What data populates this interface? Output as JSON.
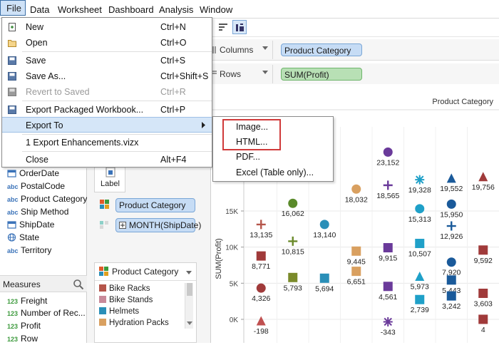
{
  "menubar": {
    "items": [
      "File",
      "Data",
      "Worksheet",
      "Dashboard",
      "Analysis",
      "Window"
    ]
  },
  "file_menu": {
    "items": [
      {
        "label": "New",
        "shortcut": "Ctrl+N",
        "icon": "new-file-icon",
        "enabled": true
      },
      {
        "label": "Open",
        "shortcut": "Ctrl+O",
        "icon": "open-folder-icon",
        "enabled": true
      },
      {
        "label": "Save",
        "shortcut": "Ctrl+S",
        "icon": "save-icon",
        "enabled": true
      },
      {
        "label": "Save As...",
        "shortcut": "Ctrl+Shift+S",
        "icon": "save-as-icon",
        "enabled": true
      },
      {
        "label": "Revert to Saved",
        "shortcut": "Ctrl+R",
        "icon": "revert-icon",
        "enabled": false
      },
      {
        "label": "Export Packaged Workbook...",
        "shortcut": "Ctrl+P",
        "icon": "export-packaged-icon",
        "enabled": true
      },
      {
        "label": "Export To",
        "shortcut": "",
        "icon": "",
        "enabled": true,
        "submenu": true
      },
      {
        "label": "1  Export Enhancements.vizx",
        "shortcut": "",
        "icon": "",
        "enabled": true
      },
      {
        "label": "Close",
        "shortcut": "Alt+F4",
        "icon": "",
        "enabled": true
      }
    ]
  },
  "export_submenu": {
    "items": [
      "Image...",
      "HTML...",
      "PDF...",
      "Excel (Table only)..."
    ]
  },
  "shelves": {
    "columns_label": "Columns",
    "columns_pill": "Product Category",
    "rows_label": "Rows",
    "rows_pill": "SUM(Profit)"
  },
  "data_pane": {
    "dimensions": [
      {
        "tag": "",
        "label": "OrderDate",
        "icon": "calendar-icon"
      },
      {
        "tag": "abc",
        "label": "PostalCode"
      },
      {
        "tag": "abc",
        "label": "Product Category"
      },
      {
        "tag": "abc",
        "label": "Ship Method"
      },
      {
        "tag": "",
        "label": "ShipDate",
        "icon": "calendar-icon"
      },
      {
        "tag": "",
        "label": "State",
        "icon": "globe-icon"
      },
      {
        "tag": "abc",
        "label": "Territory"
      }
    ],
    "measures_title": "Measures",
    "measures": [
      {
        "tag": "123",
        "label": "Freight"
      },
      {
        "tag": "123",
        "label": "Number of Rec..."
      },
      {
        "tag": "123",
        "label": "Profit"
      },
      {
        "tag": "123",
        "label": "Row"
      }
    ]
  },
  "marks_pane": {
    "label_button": "Label",
    "color_pill": "Product Category",
    "detail_pill": "MONTH(ShipDate)",
    "legend_title": "Product Category",
    "legend_items": [
      {
        "label": "Bike Racks",
        "color": "#b5554a"
      },
      {
        "label": "Bike Stands",
        "color": "#c98a9a"
      },
      {
        "label": "Helmets",
        "color": "#2a8fb8"
      },
      {
        "label": "Hydration Packs",
        "color": "#d9a060"
      }
    ]
  },
  "chart_data": {
    "type": "scatter",
    "header": "Product Category",
    "ylabel": "SUM(Profit)",
    "y_ticks": [
      "15K",
      "10K",
      "5K",
      "0K"
    ],
    "ylim": [
      -2000,
      22000
    ],
    "columns": [
      {
        "points": [
          {
            "y": 13135,
            "label": "13,135",
            "shape": "plus",
            "color": "#b5554a"
          },
          {
            "y": 8771,
            "label": "8,771",
            "shape": "square",
            "color": "#a03a3a"
          },
          {
            "y": 4326,
            "label": "4,326",
            "shape": "circle",
            "color": "#a03a3a"
          },
          {
            "y": -198,
            "label": "-198",
            "shape": "triangle",
            "color": "#c05050"
          }
        ]
      },
      {
        "points": [
          {
            "y": 16062,
            "label": "16,062",
            "shape": "circle",
            "color": "#5a8a2a"
          },
          {
            "y": 10815,
            "label": "10,815",
            "shape": "plus",
            "color": "#6a8a2a"
          },
          {
            "y": 5793,
            "label": "5,793",
            "shape": "square",
            "color": "#7a8a2a"
          }
        ]
      },
      {
        "points": [
          {
            "y": 13140,
            "label": "13,140",
            "shape": "circle",
            "color": "#2a8fb8"
          },
          {
            "y": 5694,
            "label": "5,694",
            "shape": "square",
            "color": "#2a8fb8"
          }
        ]
      },
      {
        "points": [
          {
            "y": 18032,
            "label": "18,032",
            "shape": "circle",
            "color": "#d9a060"
          },
          {
            "y": 9445,
            "label": "9,445",
            "shape": "square",
            "color": "#d9a060"
          },
          {
            "y": 6651,
            "label": "6,651",
            "shape": "square",
            "color": "#d9a060"
          }
        ]
      },
      {
        "points": [
          {
            "y": 23152,
            "label": "23,152",
            "shape": "circle",
            "color": "#6a3a9a"
          },
          {
            "y": 18565,
            "label": "18,565",
            "shape": "plus",
            "color": "#6a3a9a"
          },
          {
            "y": 9915,
            "label": "9,915",
            "shape": "square",
            "color": "#6a3a9a"
          },
          {
            "y": 4561,
            "label": "4,561",
            "shape": "square",
            "color": "#6a3a9a"
          },
          {
            "y": -343,
            "label": "-343",
            "shape": "asterisk",
            "color": "#6a3a9a"
          }
        ]
      },
      {
        "points": [
          {
            "y": 19328,
            "label": "19,328",
            "shape": "asterisk",
            "color": "#1fa0c8"
          },
          {
            "y": 15313,
            "label": "15,313",
            "shape": "circle",
            "color": "#1fa0c8"
          },
          {
            "y": 10507,
            "label": "10,507",
            "shape": "square",
            "color": "#1fa0c8"
          },
          {
            "y": 5973,
            "label": "5,973",
            "shape": "triangle",
            "color": "#1fa0c8"
          },
          {
            "y": 2739,
            "label": "2,739",
            "shape": "square",
            "color": "#1fa0c8"
          }
        ]
      },
      {
        "points": [
          {
            "y": 19552,
            "label": "19,552",
            "shape": "triangle",
            "color": "#1a5a9a"
          },
          {
            "y": 15950,
            "label": "15,950",
            "shape": "circle",
            "color": "#1a5a9a"
          },
          {
            "y": 12926,
            "label": "12,926",
            "shape": "plus",
            "color": "#1a5a9a"
          },
          {
            "y": 7920,
            "label": "7,920",
            "shape": "circle",
            "color": "#1a5a9a"
          },
          {
            "y": 5443,
            "label": "5,443",
            "shape": "square",
            "color": "#1a5a9a"
          },
          {
            "y": 3242,
            "label": "3,242",
            "shape": "square",
            "color": "#1a5a9a"
          }
        ]
      },
      {
        "points": [
          {
            "y": 19756,
            "label": "19,756",
            "shape": "triangle",
            "color": "#a03a3a"
          },
          {
            "y": 9592,
            "label": "9,592",
            "shape": "square",
            "color": "#a03a3a"
          },
          {
            "y": 3603,
            "label": "3,603",
            "shape": "square",
            "color": "#a03a3a"
          },
          {
            "y": 4,
            "label": "4",
            "shape": "square",
            "color": "#a03a3a"
          }
        ]
      }
    ]
  }
}
